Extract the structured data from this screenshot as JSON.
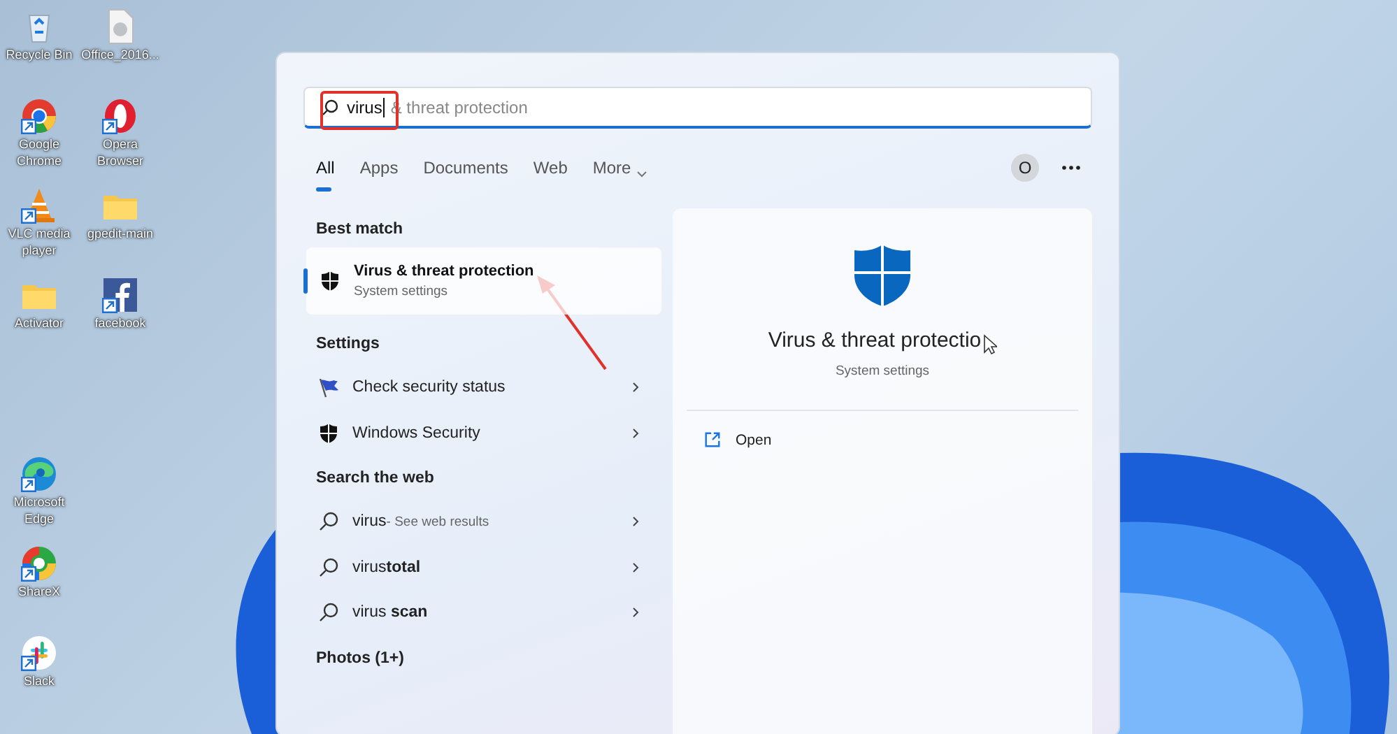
{
  "desktop_icons": [
    {
      "label": "Recycle Bin",
      "kind": "recycle",
      "shortcut": false
    },
    {
      "label": "Office_2016...",
      "kind": "file",
      "shortcut": false
    },
    {
      "label": "Google Chrome",
      "kind": "chrome",
      "shortcut": true
    },
    {
      "label": "Opera Browser",
      "kind": "opera",
      "shortcut": true
    },
    {
      "label": "VLC media player",
      "kind": "vlc",
      "shortcut": true
    },
    {
      "label": "gpedit-main",
      "kind": "folder",
      "shortcut": false
    },
    {
      "label": "Activator",
      "kind": "folder",
      "shortcut": false
    },
    {
      "label": "facebook",
      "kind": "facebook",
      "shortcut": true
    },
    {
      "label": "Microsoft Edge",
      "kind": "edge",
      "shortcut": true
    },
    {
      "label": "ShareX",
      "kind": "sharex",
      "shortcut": true
    },
    {
      "label": "Slack",
      "kind": "slack",
      "shortcut": true
    }
  ],
  "search": {
    "value": "virus",
    "completion": "& threat protection"
  },
  "tabs": [
    {
      "label": "All",
      "selected": true,
      "dropdown": false
    },
    {
      "label": "Apps",
      "selected": false,
      "dropdown": false
    },
    {
      "label": "Documents",
      "selected": false,
      "dropdown": false
    },
    {
      "label": "Web",
      "selected": false,
      "dropdown": false
    },
    {
      "label": "More",
      "selected": false,
      "dropdown": true
    }
  ],
  "account": {
    "initial": "O"
  },
  "best_match": {
    "heading": "Best match",
    "title": "Virus & threat protection",
    "subtitle": "System settings",
    "selected": true
  },
  "sections": [
    {
      "heading": "Settings",
      "items": [
        {
          "kind": "flag",
          "text": "Check security status"
        },
        {
          "kind": "shield",
          "text": "Windows Security"
        }
      ]
    },
    {
      "heading": "Search the web",
      "items": [
        {
          "kind": "search",
          "text": "virus",
          "hint": "- See web results"
        },
        {
          "kind": "search",
          "text": "virus**total**"
        },
        {
          "kind": "search",
          "text": "virus **scan**"
        }
      ]
    },
    {
      "heading": "Photos (1+)"
    }
  ],
  "detail": {
    "title": "Virus & threat protectio",
    "subtitle": "System settings",
    "actions": [
      "Open"
    ]
  }
}
